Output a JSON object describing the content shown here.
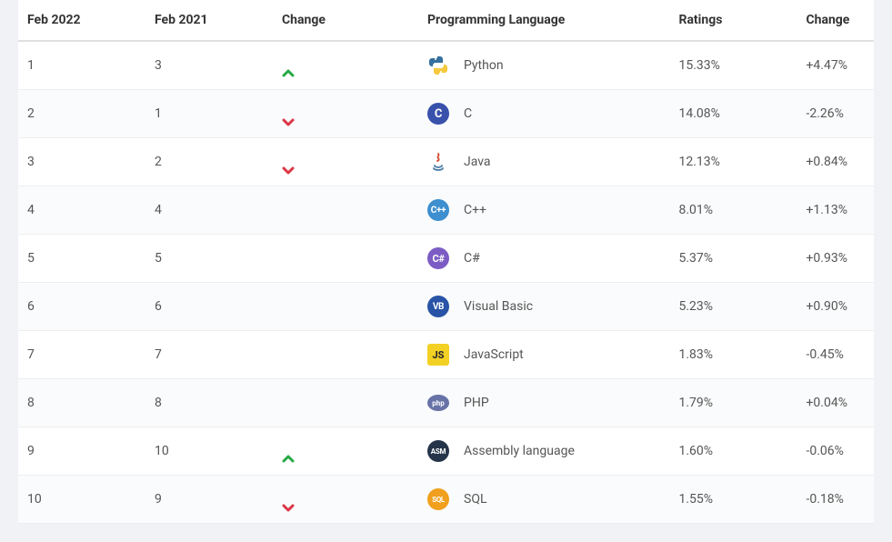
{
  "headers": {
    "feb2022": "Feb 2022",
    "feb2021": "Feb 2021",
    "trend": "Change",
    "language": "Programming Language",
    "ratings": "Ratings",
    "change": "Change"
  },
  "rows": [
    {
      "feb2022": "1",
      "feb2021": "3",
      "trend": "up",
      "icon": "python",
      "language": "Python",
      "ratings": "15.33%",
      "change": "+4.47%"
    },
    {
      "feb2022": "2",
      "feb2021": "1",
      "trend": "down",
      "icon": "c",
      "language": "C",
      "ratings": "14.08%",
      "change": "-2.26%"
    },
    {
      "feb2022": "3",
      "feb2021": "2",
      "trend": "down",
      "icon": "java",
      "language": "Java",
      "ratings": "12.13%",
      "change": "+0.84%"
    },
    {
      "feb2022": "4",
      "feb2021": "4",
      "trend": "same",
      "icon": "cpp",
      "language": "C++",
      "ratings": "8.01%",
      "change": "+1.13%"
    },
    {
      "feb2022": "5",
      "feb2021": "5",
      "trend": "same",
      "icon": "csharp",
      "language": "C#",
      "ratings": "5.37%",
      "change": "+0.93%"
    },
    {
      "feb2022": "6",
      "feb2021": "6",
      "trend": "same",
      "icon": "vb",
      "language": "Visual Basic",
      "ratings": "5.23%",
      "change": "+0.90%"
    },
    {
      "feb2022": "7",
      "feb2021": "7",
      "trend": "same",
      "icon": "js",
      "language": "JavaScript",
      "ratings": "1.83%",
      "change": "-0.45%"
    },
    {
      "feb2022": "8",
      "feb2021": "8",
      "trend": "same",
      "icon": "php",
      "language": "PHP",
      "ratings": "1.79%",
      "change": "+0.04%"
    },
    {
      "feb2022": "9",
      "feb2021": "10",
      "trend": "up",
      "icon": "asm",
      "language": "Assembly language",
      "ratings": "1.60%",
      "change": "-0.06%"
    },
    {
      "feb2022": "10",
      "feb2021": "9",
      "trend": "down",
      "icon": "sql",
      "language": "SQL",
      "ratings": "1.55%",
      "change": "-0.18%"
    }
  ]
}
